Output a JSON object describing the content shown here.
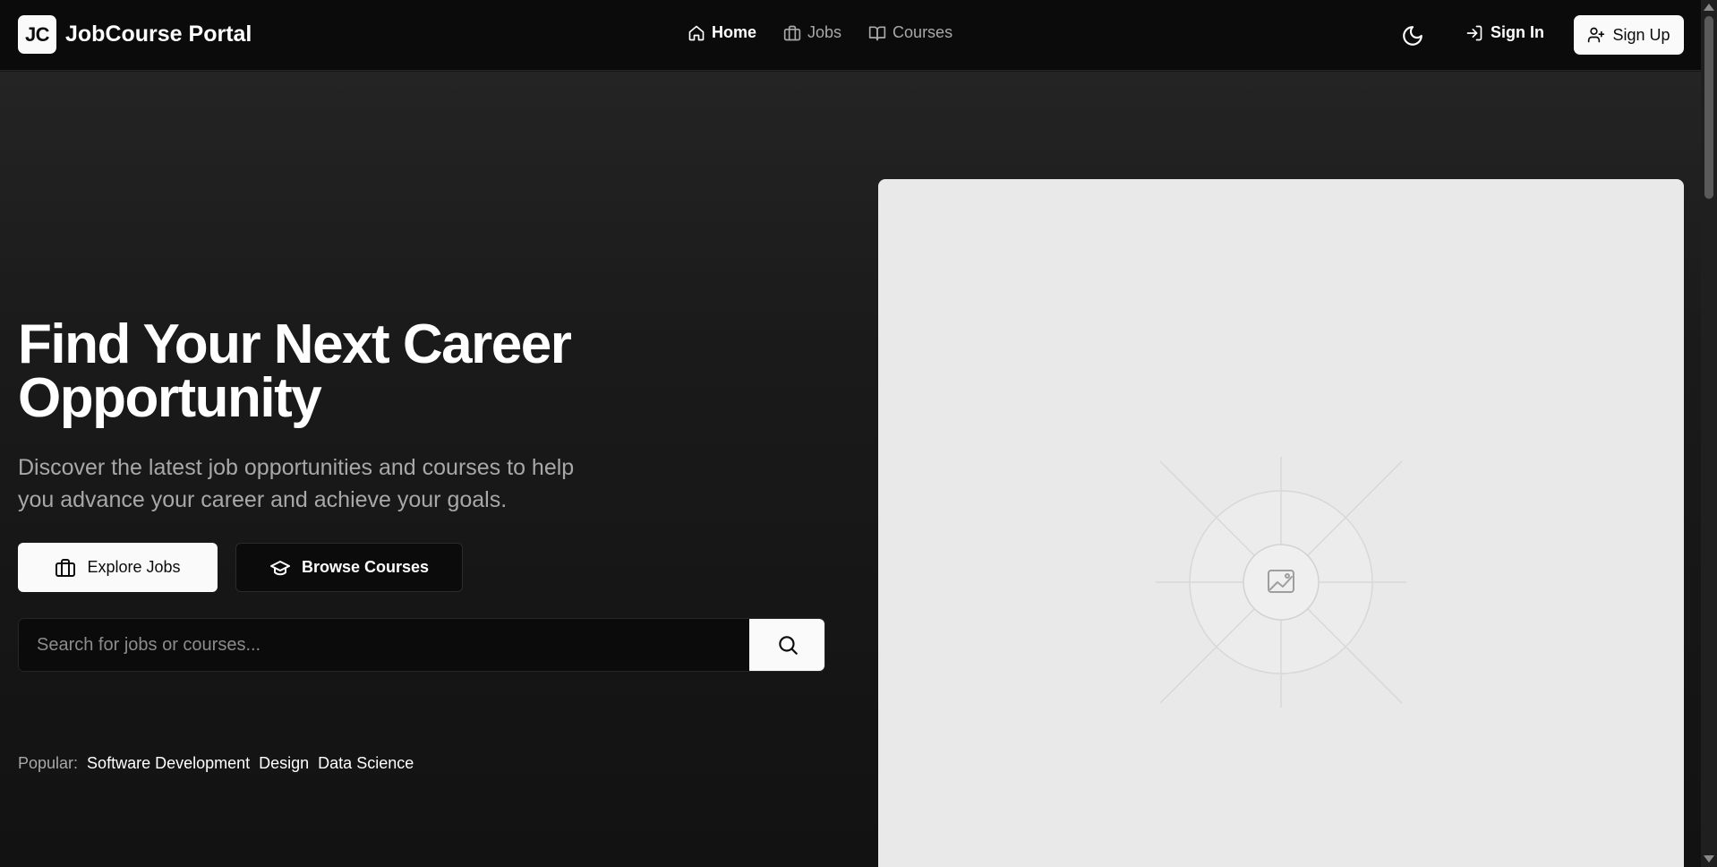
{
  "header": {
    "logo_text": "JC",
    "brand": "JobCourse Portal",
    "nav": [
      {
        "label": "Home",
        "icon": "home-icon",
        "active": true
      },
      {
        "label": "Jobs",
        "icon": "briefcase-icon",
        "active": false
      },
      {
        "label": "Courses",
        "icon": "book-open-icon",
        "active": false
      }
    ],
    "theme_icon": "moon-icon",
    "signin_label": "Sign In",
    "signup_label": "Sign Up"
  },
  "hero": {
    "title": "Find Your Next Career Opportunity",
    "subtitle": "Discover the latest job opportunities and courses to help you advance your career and achieve your goals.",
    "primary_button": "Explore Jobs",
    "secondary_button": "Browse Courses",
    "search": {
      "placeholder": "Search for jobs or courses...",
      "value": ""
    },
    "popular_label": "Popular:",
    "popular_tags": [
      "Software Development",
      "Design",
      "Data Science"
    ]
  },
  "media": {
    "placeholder_icon": "image-icon"
  },
  "colors": {
    "header_bg": "#0b0b0b",
    "hero_bg_top": "#242424",
    "hero_bg_bottom": "#121212",
    "button_light": "#fafafa",
    "text_muted": "#a8a8a8",
    "placeholder_bg": "#e9e9e9"
  }
}
